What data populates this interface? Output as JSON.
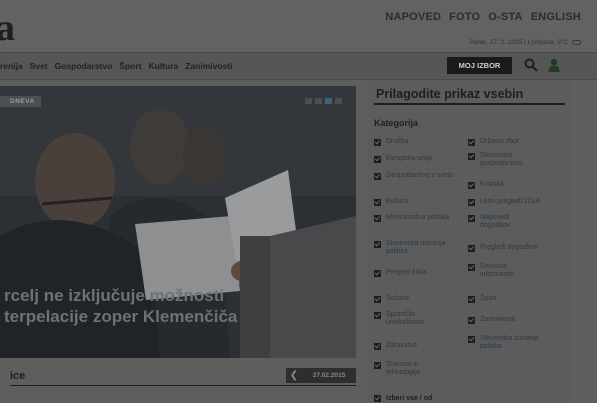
{
  "header": {
    "logo": "a",
    "top_links": [
      "NAPOVED",
      "FOTO",
      "O-STA",
      "ENGLISH"
    ],
    "date_text": "Petek, 27. 2. 2015 |",
    "location_text": "Ljubljana, 9°C"
  },
  "nav": {
    "items": [
      "renija",
      "Svet",
      "Gospodarstvo",
      "Šport",
      "Kultura",
      "Zanimivosti"
    ],
    "moj_izbor": "MOJ IZBOR"
  },
  "hero": {
    "ticker": "DNEVA",
    "headline_line1": "rcelj ne izključuje možnosti",
    "headline_line2": "terpelacije zoper Klemenčiča"
  },
  "section": {
    "label": "ice",
    "date": "27.02.2015"
  },
  "panel": {
    "title": "Prilagodite prikaz vsebin",
    "category_heading": "Kategorija",
    "left": [
      "Družba",
      "Evropska unija",
      "Gospodarstvo v svetu",
      "Kultura",
      "Mednarodna politika",
      "Slovenska notranja politika",
      "Pregled tiska",
      "Šolstvo",
      "Sporočila uredništvom",
      "Zdravstvo",
      "Znanost in tehnologija"
    ],
    "right": [
      "Državni zbor",
      "Slovensko gospodarstvo",
      "Kronika",
      "Letni pregledi 2014",
      "Napovedi dogodkov",
      "Pregledi dogodkov",
      "Servisne informacije",
      "Šport",
      "Zanimivosti",
      "Slovenska zunanja politika"
    ],
    "select_all": "Izberi vse / od"
  },
  "colors": {
    "overlay": "#5e5e5e",
    "label_text": "#2b3a47",
    "dark": "#1e1e1e"
  }
}
